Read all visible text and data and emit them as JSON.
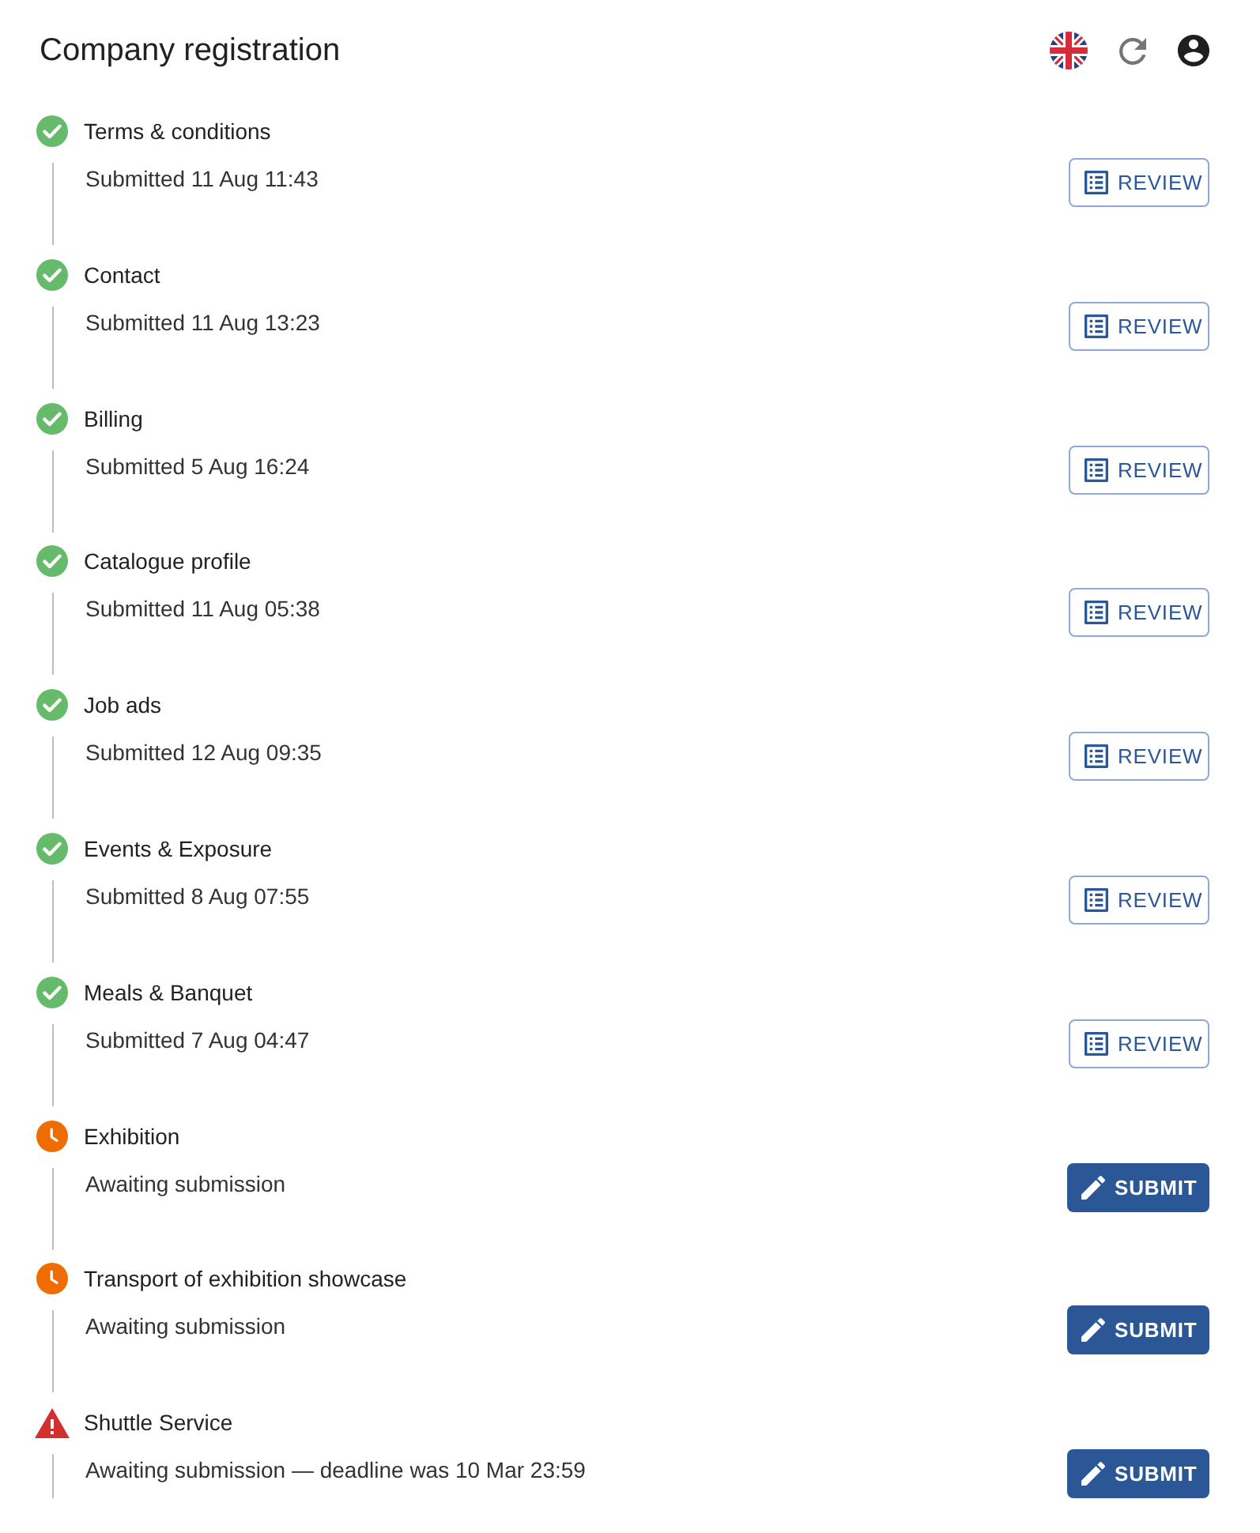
{
  "header": {
    "title": "Company registration"
  },
  "steps": [
    {
      "kind": "done",
      "title": "Terms & conditions",
      "detail": "Submitted 11 Aug 11:43",
      "action": {
        "kind": "review",
        "label": "REVIEW"
      }
    },
    {
      "kind": "done",
      "title": "Contact",
      "detail": "Submitted 11 Aug 13:23",
      "action": {
        "kind": "review",
        "label": "REVIEW"
      }
    },
    {
      "kind": "done",
      "title": "Billing",
      "detail": "Submitted 5 Aug 16:24",
      "action": {
        "kind": "review",
        "label": "REVIEW"
      }
    },
    {
      "kind": "done",
      "title": "Catalogue profile",
      "detail": "Submitted 11 Aug 05:38",
      "action": {
        "kind": "review",
        "label": "REVIEW"
      }
    },
    {
      "kind": "done",
      "title": "Job ads",
      "detail": "Submitted 12 Aug 09:35",
      "action": {
        "kind": "review",
        "label": "REVIEW"
      }
    },
    {
      "kind": "done",
      "title": "Events & Exposure",
      "detail": "Submitted 8 Aug 07:55",
      "action": {
        "kind": "review",
        "label": "REVIEW"
      }
    },
    {
      "kind": "done",
      "title": "Meals & Banquet",
      "detail": "Submitted 7 Aug 04:47",
      "action": {
        "kind": "review",
        "label": "REVIEW"
      }
    },
    {
      "kind": "pending",
      "title": "Exhibition",
      "detail": "Awaiting submission",
      "action": {
        "kind": "submit",
        "label": "SUBMIT"
      }
    },
    {
      "kind": "pending",
      "title": "Transport of exhibition showcase",
      "detail": "Awaiting submission",
      "action": {
        "kind": "submit",
        "label": "SUBMIT"
      }
    },
    {
      "kind": "overdue",
      "title": "Shuttle Service",
      "detail": "Awaiting submission — deadline was 10 Mar 23:59",
      "action": {
        "kind": "submit",
        "label": "SUBMIT"
      }
    }
  ]
}
